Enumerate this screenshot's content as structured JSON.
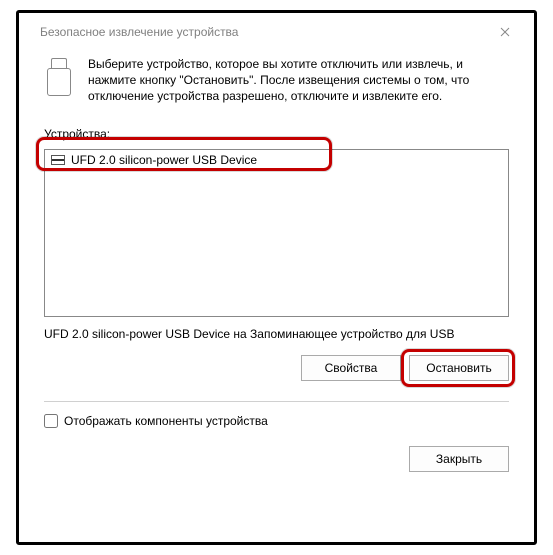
{
  "window": {
    "title": "Безопасное извлечение устройства",
    "close_tooltip": "Закрыть"
  },
  "intro": {
    "text": "Выберите устройство, которое вы хотите отключить или извлечь, и нажмите кнопку \"Остановить\". После извещения системы о том, что отключение устройства разрешено, отключите и извлеките его."
  },
  "devices": {
    "label": "Устройства:",
    "items": [
      {
        "name": "UFD 2.0 silicon-power USB Device"
      }
    ],
    "status": "UFD 2.0 silicon-power USB Device на Запоминающее устройство для USB"
  },
  "buttons": {
    "properties": "Свойства",
    "stop": "Остановить",
    "close": "Закрыть"
  },
  "options": {
    "show_components": "Отображать компоненты устройства"
  }
}
